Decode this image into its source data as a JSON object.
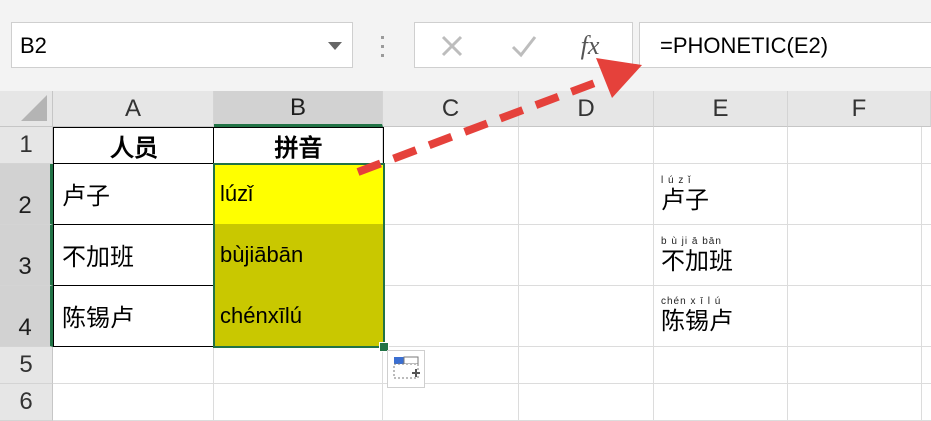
{
  "name_box": {
    "value": "B2"
  },
  "formula_bar": {
    "fx_label": "fx",
    "value": "=PHONETIC(E2)"
  },
  "columns": [
    "A",
    "B",
    "C",
    "D",
    "E",
    "F"
  ],
  "rows": [
    "1",
    "2",
    "3",
    "4",
    "5",
    "6"
  ],
  "cells": {
    "A1": "人员",
    "B1": "拼音",
    "A2": "卢子",
    "B2": "lúzǐ",
    "A3": "不加班",
    "B3": "bùjiābān",
    "A4": "陈锡卢",
    "B4": "chénxīlú"
  },
  "phonetic_cells": [
    {
      "ruby": "l ú  z ǐ",
      "text": "卢子"
    },
    {
      "ruby": "b ù  ji  ā bān",
      "text": "不加班"
    },
    {
      "ruby": "chén x  ī  l ú",
      "text": "陈锡卢"
    }
  ],
  "colors": {
    "active_cell_fill": "#ffff00",
    "selected_cells_fill": "#c9c800",
    "selection_border": "#217346",
    "arrow": "#e5413b"
  },
  "icons": [
    "cancel-icon",
    "enter-check-icon",
    "dropdown-arrow-icon",
    "paste-options-icon",
    "dashed-arrow-annotation"
  ]
}
